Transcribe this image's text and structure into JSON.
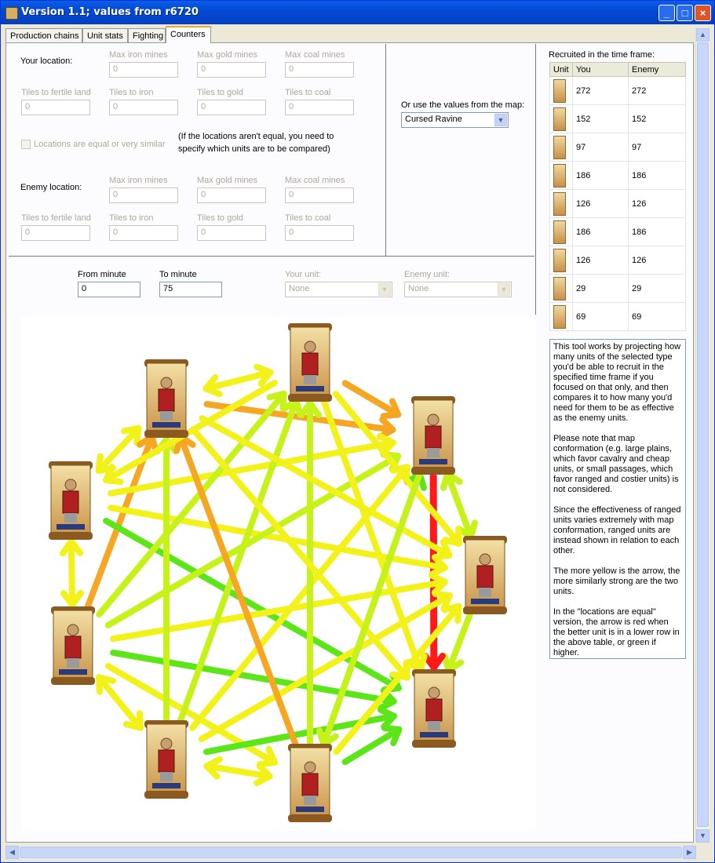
{
  "window": {
    "title": "Version 1.1; values from r6720"
  },
  "tabs": [
    {
      "label": "Production chains"
    },
    {
      "label": "Unit stats"
    },
    {
      "label": "Fighting"
    },
    {
      "label": "Counters"
    }
  ],
  "your_location": {
    "label": "Your location:",
    "max_iron_label": "Max iron mines",
    "max_iron": "0",
    "max_gold_label": "Max gold mines",
    "max_gold": "0",
    "max_coal_label": "Max coal mines",
    "max_coal": "0",
    "fertile_label": "Tiles to fertile land",
    "fertile": "0",
    "iron_label": "Tiles to iron",
    "iron": "0",
    "gold_label": "Tiles to gold",
    "gold": "0",
    "coal_label": "Tiles to coal",
    "coal": "0"
  },
  "equal_checkbox": {
    "label": "Locations are equal or very similar"
  },
  "equal_note": {
    "line1": "(If the locations aren't equal, you need to",
    "line2": "specify which units are to be compared)"
  },
  "enemy_location": {
    "label": "Enemy location:",
    "max_iron_label": "Max iron mines",
    "max_iron": "0",
    "max_gold_label": "Max gold mines",
    "max_gold": "0",
    "max_coal_label": "Max coal mines",
    "max_coal": "0",
    "fertile_label": "Tiles to fertile land",
    "fertile": "0",
    "iron_label": "Tiles to iron",
    "iron": "0",
    "gold_label": "Tiles to gold",
    "gold": "0",
    "coal_label": "Tiles to coal",
    "coal": "0"
  },
  "map": {
    "label": "Or use the values from the map:",
    "selected": "Cursed Ravine"
  },
  "time": {
    "from_label": "From minute",
    "from": "0",
    "to_label": "To minute",
    "to": "75"
  },
  "units": {
    "your_label": "Your unit:",
    "your_selected": "None",
    "enemy_label": "Enemy unit:",
    "enemy_selected": "None"
  },
  "recruited": {
    "title": "Recruited in the time frame:",
    "headers": [
      "Unit",
      "You",
      "Enemy"
    ],
    "rows": [
      {
        "you": "272",
        "enemy": "272"
      },
      {
        "you": "152",
        "enemy": "152"
      },
      {
        "you": "97",
        "enemy": "97"
      },
      {
        "you": "186",
        "enemy": "186"
      },
      {
        "you": "126",
        "enemy": "126"
      },
      {
        "you": "186",
        "enemy": "186"
      },
      {
        "you": "126",
        "enemy": "126"
      },
      {
        "you": "29",
        "enemy": "29"
      },
      {
        "you": "69",
        "enemy": "69"
      }
    ]
  },
  "info": {
    "p1": "This tool works by projecting how many units of the selected type you'd be able to recruit in the specified time frame if you focused on that only, and then compares it to how many you'd need for them to be as effective as the enemy units.",
    "p2": "Please note that map conformation (e.g. large plains, which favor cavalry and cheap units, or small passages, which favor ranged and costier units) is not considered.",
    "p3": "Since the effectiveness of ranged units varies extremely with map conformation, ranged units are instead shown in relation to each other.",
    "p4": "The more yellow is the arrow, the more similarly strong are the two units.",
    "p5": "In the \"locations are equal\" version, the arrow is red when the better unit is in a lower row in the above table, or green if higher."
  },
  "colors": {
    "red": "#ff1a1a",
    "orange": "#f5a623",
    "yellow": "#f2f21a",
    "lime": "#c6f21a",
    "green": "#5ce61a"
  }
}
